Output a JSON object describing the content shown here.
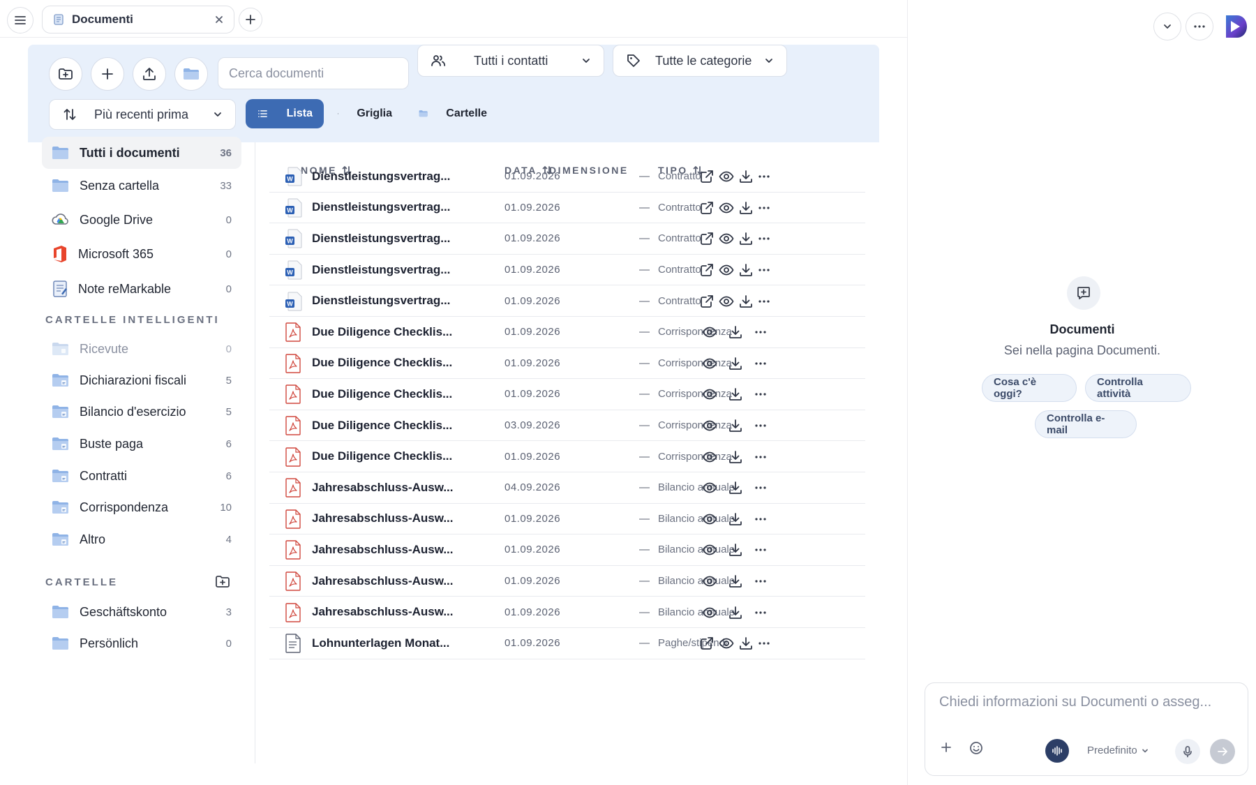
{
  "tab": {
    "title": "Documenti",
    "icon": "document-icon"
  },
  "toolbar": {
    "search_placeholder": "Cerca documenti",
    "contacts_filter": "Tutti i contatti",
    "categories_filter": "Tutte le categorie",
    "sort": "Più recenti prima",
    "views": [
      "Lista",
      "Griglia",
      "Cartelle"
    ],
    "active_view": "Lista"
  },
  "sidebar": {
    "items": [
      {
        "label": "Tutti i documenti",
        "count": "36",
        "active": true
      },
      {
        "label": "Senza cartella",
        "count": "33"
      },
      {
        "label": "Google Drive",
        "count": "0"
      },
      {
        "label": "Microsoft 365",
        "count": "0"
      },
      {
        "label": "Note reMarkable",
        "count": "0"
      }
    ],
    "smart_title": "CARTELLE INTELLIGENTI",
    "smart": [
      {
        "label": "Ricevute",
        "count": "0",
        "muted": true
      },
      {
        "label": "Dichiarazioni fiscali",
        "count": "5"
      },
      {
        "label": "Bilancio d'esercizio",
        "count": "5"
      },
      {
        "label": "Buste paga",
        "count": "6"
      },
      {
        "label": "Contratti",
        "count": "6"
      },
      {
        "label": "Corrispondenza",
        "count": "10"
      },
      {
        "label": "Altro",
        "count": "4"
      }
    ],
    "folders_title": "CARTELLE",
    "folders": [
      {
        "label": "Geschäftskonto",
        "count": "3"
      },
      {
        "label": "Persönlich",
        "count": "0"
      }
    ]
  },
  "table": {
    "headers": {
      "name": "NOME",
      "date": "DATA",
      "size": "DIMENSIONE",
      "type": "TIPO"
    },
    "rows": [
      {
        "name": "Dienstleistungsvertrag...",
        "date": "01.09.2026",
        "size": "—",
        "type": "Contratto",
        "kind": "word"
      },
      {
        "name": "Dienstleistungsvertrag...",
        "date": "01.09.2026",
        "size": "—",
        "type": "Contratto",
        "kind": "word"
      },
      {
        "name": "Dienstleistungsvertrag...",
        "date": "01.09.2026",
        "size": "—",
        "type": "Contratto",
        "kind": "word"
      },
      {
        "name": "Dienstleistungsvertrag...",
        "date": "01.09.2026",
        "size": "—",
        "type": "Contratto",
        "kind": "word"
      },
      {
        "name": "Dienstleistungsvertrag...",
        "date": "01.09.2026",
        "size": "—",
        "type": "Contratto",
        "kind": "word"
      },
      {
        "name": "Due Diligence Checklis...",
        "date": "01.09.2026",
        "size": "—",
        "type": "Corrispondenza",
        "kind": "pdf"
      },
      {
        "name": "Due Diligence Checklis...",
        "date": "01.09.2026",
        "size": "—",
        "type": "Corrispondenza",
        "kind": "pdf"
      },
      {
        "name": "Due Diligence Checklis...",
        "date": "01.09.2026",
        "size": "—",
        "type": "Corrispondenza",
        "kind": "pdf"
      },
      {
        "name": "Due Diligence Checklis...",
        "date": "03.09.2026",
        "size": "—",
        "type": "Corrispondenza",
        "kind": "pdf"
      },
      {
        "name": "Due Diligence Checklis...",
        "date": "01.09.2026",
        "size": "—",
        "type": "Corrispondenza",
        "kind": "pdf"
      },
      {
        "name": "Jahresabschluss-Ausw...",
        "date": "04.09.2026",
        "size": "—",
        "type": "Bilancio annuale",
        "kind": "pdf"
      },
      {
        "name": "Jahresabschluss-Ausw...",
        "date": "01.09.2026",
        "size": "—",
        "type": "Bilancio annuale",
        "kind": "pdf"
      },
      {
        "name": "Jahresabschluss-Ausw...",
        "date": "01.09.2026",
        "size": "—",
        "type": "Bilancio annuale",
        "kind": "pdf"
      },
      {
        "name": "Jahresabschluss-Ausw...",
        "date": "01.09.2026",
        "size": "—",
        "type": "Bilancio annuale",
        "kind": "pdf"
      },
      {
        "name": "Jahresabschluss-Ausw...",
        "date": "01.09.2026",
        "size": "—",
        "type": "Bilancio annuale",
        "kind": "pdf"
      },
      {
        "name": "Lohnunterlagen Monat...",
        "date": "01.09.2026",
        "size": "—",
        "type": "Paghe/stipendi",
        "kind": "doc"
      }
    ]
  },
  "assistant": {
    "title": "Documenti",
    "subtitle": "Sei nella pagina Documenti.",
    "chips": [
      "Cosa c'è oggi?",
      "Controlla attività",
      "Controlla e-mail"
    ],
    "input_placeholder": "Chiedi informazioni su Documenti o asseg...",
    "model": "Predefinito"
  },
  "colors": {
    "accent": "#3d6bb3",
    "toolbar_bg": "#e8f0fb",
    "pdf_red": "#d0473d",
    "word_blue": "#2b5fb4"
  }
}
